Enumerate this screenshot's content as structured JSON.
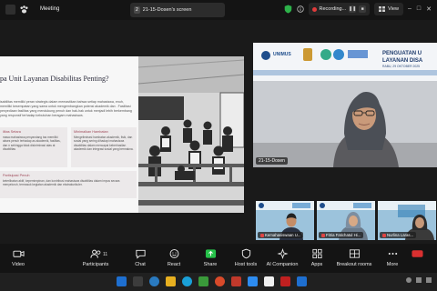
{
  "window": {
    "meeting_title": "Meeting",
    "share_tab_number": "2",
    "share_tab_title": "21-15-Dosen's screen",
    "recording_label": "Recording...",
    "view_label": "View"
  },
  "slide": {
    "title": "pa Unit Layanan Disabilitas Penting?",
    "intro": "isabilitas memiliki peran strategis dalam memastikan bahwa setiap mahasiswa, enuh, memiliki kesempatan yang sama untuk mengembangkan potensi akademik dan . Fasilitasi penyediaan fasilitas yang mendukung penuh dan hak-hak untuk menjadi lebih berkembang yang responsif terhadap kebutuhan beragam mahasiswa.",
    "cards": [
      {
        "heading": "ilitas Setara",
        "body": "masa mahasiswa penyandang tas memiliki akses penuh terhadap as akademik, fasilitas, dan n sehingga tidak diskriminasi atas at disabilitas"
      },
      {
        "heading": "Minimalkan Hambatan",
        "body": "Mengeliminasi hambatan akademik, fisik, dan sosial yang sering dihadapi mahasiswa disabilitas dalam mencapai keberhasilan akademik dan integrasi sosial yang bermakna."
      },
      {
        "heading": "Partisipasi Penuh",
        "body": "keterlibatan aktif, kepemimpinan, dan kontribusi mahasiswa disabilitas dalam impus secara menyeluruh, termasuk kegiatan akademik dan ekstrakurikuler."
      }
    ]
  },
  "speaker": {
    "name": "21-15-Dosen",
    "banner_logo_text": "UNIMUS",
    "banner_title_line1": "PENGUATAN U",
    "banner_title_line2": "LAYANAN DISA",
    "banner_date": "RABU, 29 OKTOBER 2025"
  },
  "thumbnails": [
    {
      "name": "Kemahasiswaan U..."
    },
    {
      "name": "Fitria Fatichatul Hi..."
    },
    {
      "name": "Nurlina Laras..."
    }
  ],
  "toolbar": {
    "items": [
      {
        "label": "Video"
      },
      {
        "label": "Participants",
        "count": "11"
      },
      {
        "label": "Chat"
      },
      {
        "label": "React"
      },
      {
        "label": "Share"
      },
      {
        "label": "Host tools"
      },
      {
        "label": "AI Companion"
      },
      {
        "label": "Apps"
      },
      {
        "label": "Breakout rooms"
      },
      {
        "label": "More"
      }
    ]
  },
  "colors": {
    "share_green": "#26c24a",
    "record_red": "#e03b3b",
    "slide_accent": "#a04a5a",
    "banner_blue": "#1d3a6b"
  }
}
